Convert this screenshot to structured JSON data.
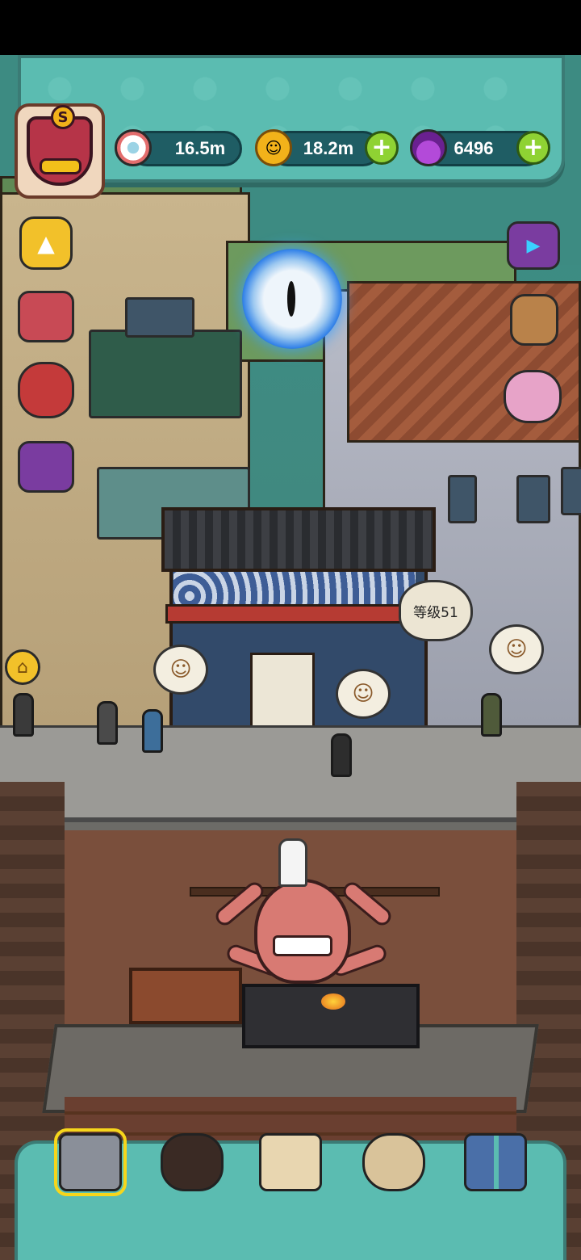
{
  "status_bar": {},
  "resources": {
    "eyeballs": {
      "value": "16.5m",
      "icon": "eyeball-icon"
    },
    "coins": {
      "value": "18.2m",
      "icon": "coin-icon"
    },
    "potions": {
      "value": "6496",
      "icon": "potion-icon"
    }
  },
  "avatar": {
    "rank": "S",
    "icon": "monster-avatar-icon"
  },
  "shop": {
    "level_label": "等级51"
  },
  "side_buttons": {
    "left": [
      "collapse-up-icon",
      "gift-box-icon",
      "fruit-bag-icon",
      "card-pack-icon",
      "home-icon"
    ],
    "right": [
      "tv-video-icon",
      "backpack-icon",
      "monster-eggs-icon"
    ]
  },
  "bottom_nav": [
    {
      "name": "building-nav",
      "icon": "shop-building-icon",
      "active": true
    },
    {
      "name": "monster-nav",
      "icon": "monster-icon",
      "active": false
    },
    {
      "name": "recipe-book-nav",
      "icon": "book-icon",
      "active": false
    },
    {
      "name": "money-bag-nav",
      "icon": "money-bag-icon",
      "active": false
    },
    {
      "name": "menu-grid-nav",
      "icon": "grid-menu-icon",
      "active": false
    }
  ],
  "colors": {
    "hud": "#5bbcb1",
    "plus": "#8fd233",
    "pill": "#1f5d64",
    "accent": "#f7d61b"
  }
}
